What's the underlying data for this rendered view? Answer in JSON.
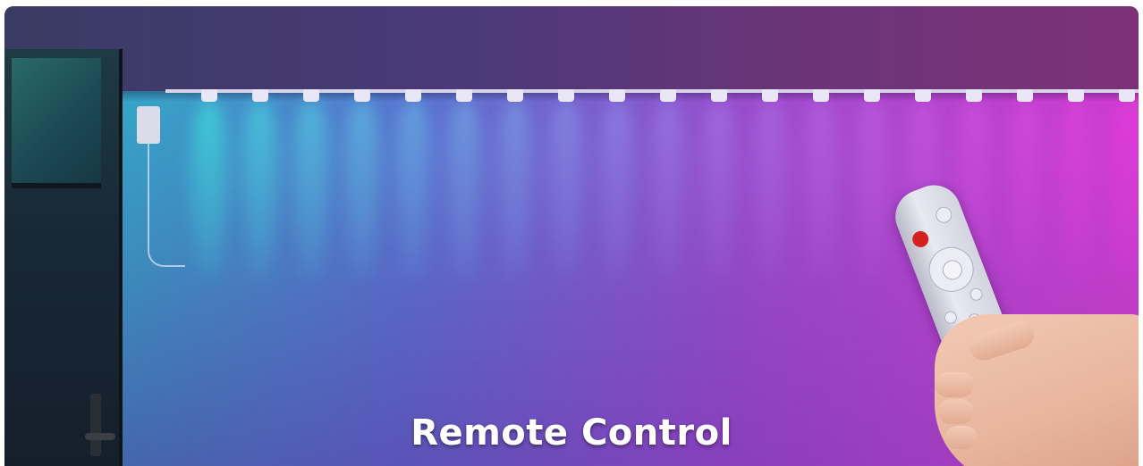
{
  "title": "Remote Control",
  "colors": {
    "left_light": "#3fe3e0",
    "mid_light": "#9b7ae8",
    "right_light": "#e83be0",
    "title_text": "#ffffff"
  }
}
